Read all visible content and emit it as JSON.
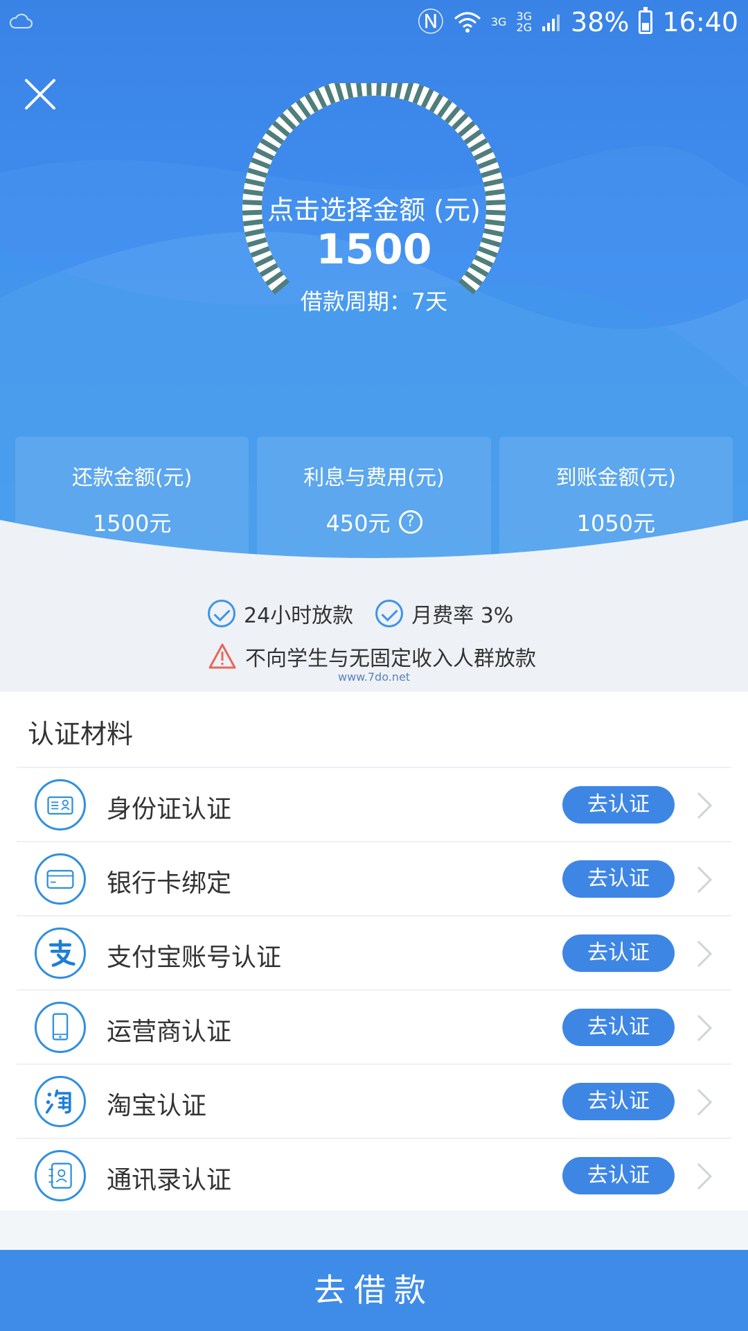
{
  "status_bar": {
    "network_a": "3G",
    "network_b": "3G",
    "network_c": "2G",
    "battery": "38%",
    "time": "16:40"
  },
  "gauge": {
    "title": "点击选择金额 (元)",
    "amount": "1500",
    "period": "借款周期：7天"
  },
  "summary": [
    {
      "label": "还款金额(元)",
      "value": "1500元"
    },
    {
      "label": "利息与费用(元)",
      "value": "450元"
    },
    {
      "label": "到账金额(元)",
      "value": "1050元"
    }
  ],
  "features": {
    "fast": "24小时放款",
    "rate": "月费率 3%",
    "notice": "不向学生与无固定收入人群放款",
    "watermark": "www.7do.net"
  },
  "auth": {
    "title": "认证材料",
    "button_label": "去认证",
    "items": [
      {
        "name": "身份证认证",
        "icon": "id-card-icon"
      },
      {
        "name": "银行卡绑定",
        "icon": "bank-card-icon"
      },
      {
        "name": "支付宝账号认证",
        "icon": "alipay-icon"
      },
      {
        "name": "运营商认证",
        "icon": "phone-icon"
      },
      {
        "name": "淘宝认证",
        "icon": "taobao-icon"
      },
      {
        "name": "通讯录认证",
        "icon": "contacts-icon"
      }
    ]
  },
  "bottom_button": "去借款",
  "colors": {
    "primary": "#3f8ce8",
    "gauge_tick": "#4f7e7c"
  }
}
